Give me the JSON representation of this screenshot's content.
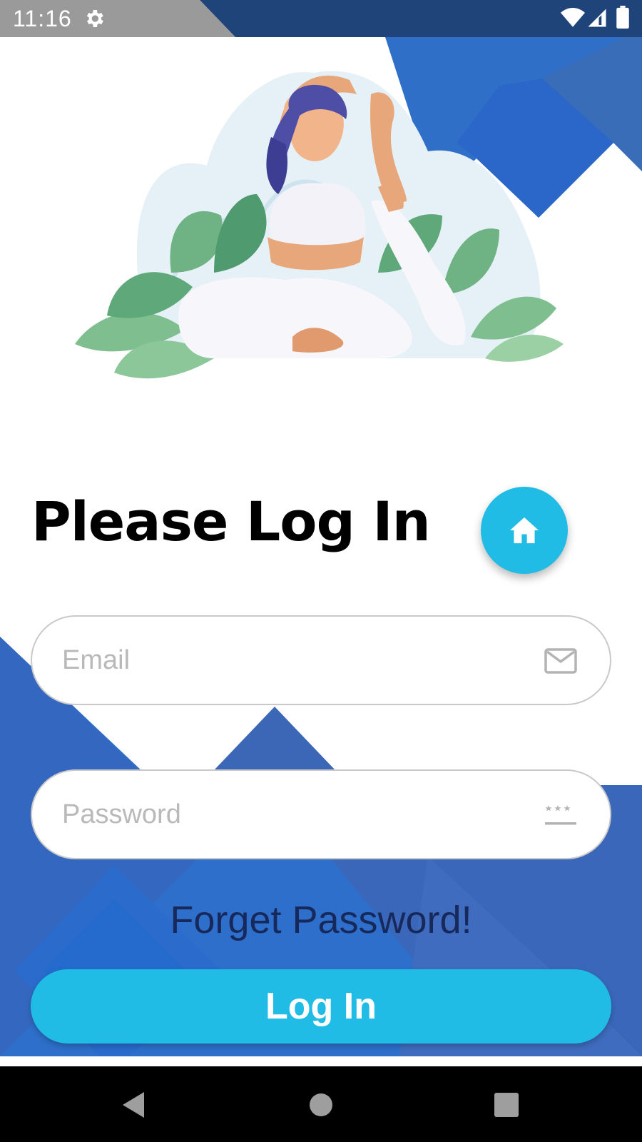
{
  "status_bar": {
    "time": "11:16",
    "icons": [
      "gear-icon",
      "wifi-icon",
      "signal-icon",
      "battery-icon"
    ]
  },
  "hero": {
    "illustration": "woman doing yoga stretch among green leaves"
  },
  "title": "Please Log In",
  "home_button": {
    "icon": "home-icon"
  },
  "email": {
    "placeholder": "Email",
    "value": "",
    "icon": "mail-icon"
  },
  "password": {
    "placeholder": "Password",
    "value": "",
    "icon": "password-icon"
  },
  "forgot_label": "Forget Password!",
  "login_label": "Log In",
  "nav_bar": {
    "icons": [
      "back-icon",
      "home-circle-icon",
      "recents-icon"
    ]
  },
  "colors": {
    "accent": "#21bce6",
    "primary_blue": "#2f6fc8",
    "forgot_text": "#17285a",
    "status_bar": "#9a9a9a"
  }
}
